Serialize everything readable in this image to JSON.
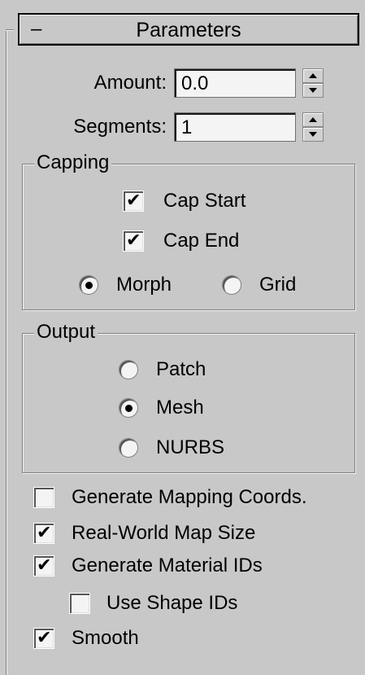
{
  "rollout": {
    "collapse_symbol": "–",
    "title": "Parameters"
  },
  "amount": {
    "label": "Amount:",
    "value": "0.0"
  },
  "segments": {
    "label": "Segments:",
    "value": "1"
  },
  "capping": {
    "title": "Capping",
    "cap_start": {
      "label": "Cap Start",
      "checked": true
    },
    "cap_end": {
      "label": "Cap End",
      "checked": true
    },
    "morph": {
      "label": "Morph",
      "selected": true
    },
    "grid": {
      "label": "Grid",
      "selected": false
    }
  },
  "output": {
    "title": "Output",
    "patch": {
      "label": "Patch",
      "selected": false
    },
    "mesh": {
      "label": "Mesh",
      "selected": true
    },
    "nurbs": {
      "label": "NURBS",
      "selected": false
    }
  },
  "options": {
    "generate_mapping_coords": {
      "label": "Generate Mapping Coords.",
      "checked": false
    },
    "real_world_map_size": {
      "label": "Real-World Map Size",
      "checked": true
    },
    "generate_material_ids": {
      "label": "Generate Material IDs",
      "checked": true
    },
    "use_shape_ids": {
      "label": "Use Shape IDs",
      "checked": false
    },
    "smooth": {
      "label": "Smooth",
      "checked": true
    }
  },
  "check_glyph": "✔"
}
